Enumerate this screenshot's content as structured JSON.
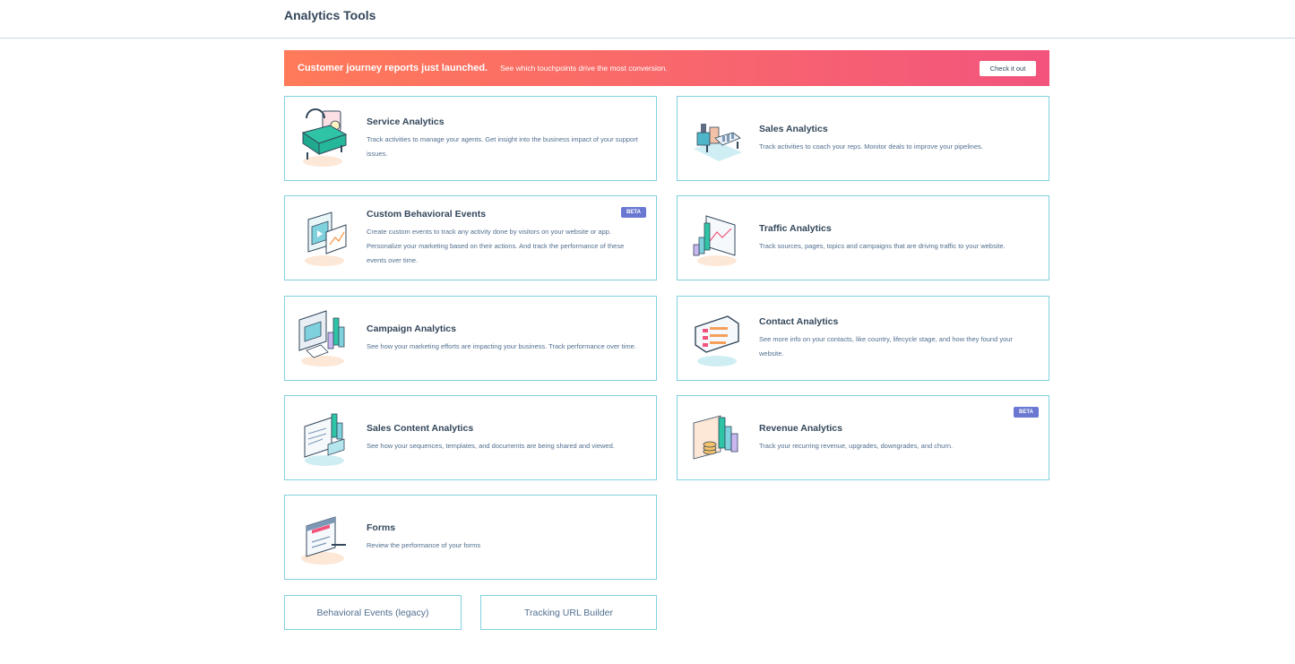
{
  "page": {
    "title": "Analytics Tools"
  },
  "banner": {
    "title": "Customer journey reports just launched.",
    "text": "See which touchpoints drive the most conversion.",
    "button": "Check it out"
  },
  "cards": [
    {
      "title": "Service Analytics",
      "desc": "Track activities to manage your agents. Get insight into the business impact of your support issues.",
      "icon": "service-analytics-icon"
    },
    {
      "title": "Sales Analytics",
      "desc": "Track activities to coach your reps. Monitor deals to improve your pipelines.",
      "icon": "sales-analytics-icon"
    },
    {
      "title": "Custom Behavioral Events",
      "desc": "Create custom events to track any activity done by visitors on your website or app. Personalize your marketing based on their actions. And track the performance of these events over time.",
      "badge": "BETA",
      "icon": "custom-events-icon"
    },
    {
      "title": "Traffic Analytics",
      "desc": "Track sources, pages, topics and campaigns that are driving traffic to your website.",
      "icon": "traffic-analytics-icon"
    },
    {
      "title": "Campaign Analytics",
      "desc": "See how your marketing efforts are impacting your business. Track performance over time.",
      "icon": "campaign-analytics-icon"
    },
    {
      "title": "Contact Analytics",
      "desc": "See more info on your contacts, like country, lifecycle stage, and how they found your website.",
      "icon": "contact-analytics-icon"
    },
    {
      "title": "Sales Content Analytics",
      "desc": "See how your sequences, templates, and documents are being shared and viewed.",
      "icon": "sales-content-analytics-icon"
    },
    {
      "title": "Revenue Analytics",
      "desc": "Track your recurring revenue, upgrades, downgrades, and churn.",
      "badge": "BETA",
      "icon": "revenue-analytics-icon"
    },
    {
      "title": "Forms",
      "desc": "Review the performance of your forms",
      "icon": "forms-icon"
    }
  ],
  "links": {
    "behavioral_legacy": "Behavioral Events (legacy)",
    "tracking_url": "Tracking URL Builder"
  },
  "colors": {
    "accent_border": "#7fd1de",
    "banner_start": "#ff7a59",
    "banner_end": "#f2547d",
    "badge": "#6a78d1",
    "text": "#33475b"
  }
}
